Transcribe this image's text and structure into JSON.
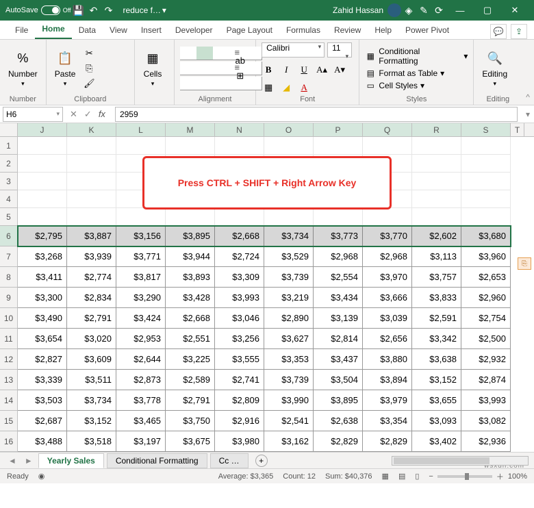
{
  "titlebar": {
    "autosave_label": "AutoSave",
    "autosave_state": "Off",
    "file_name": "reduce f…",
    "user_name": "Zahid Hassan"
  },
  "tabs": {
    "file": "File",
    "home": "Home",
    "data": "Data",
    "view": "View",
    "insert": "Insert",
    "developer": "Developer",
    "page_layout": "Page Layout",
    "formulas": "Formulas",
    "review": "Review",
    "help": "Help",
    "power_pivot": "Power Pivot"
  },
  "ribbon": {
    "number_group": "Number",
    "number_btn": "Number",
    "clipboard_group": "Clipboard",
    "paste_btn": "Paste",
    "cells_btn": "Cells",
    "alignment_group": "Alignment",
    "font_group": "Font",
    "font_name": "Calibri",
    "font_size": "11",
    "styles_group": "Styles",
    "cond_fmt": "Conditional Formatting",
    "fmt_table": "Format as Table",
    "cell_styles": "Cell Styles",
    "editing_group": "Editing",
    "editing_btn": "Editing"
  },
  "fx": {
    "name_box": "H6",
    "value": "2959"
  },
  "columns": [
    "J",
    "K",
    "L",
    "M",
    "N",
    "O",
    "P",
    "Q",
    "R",
    "S"
  ],
  "blank_rows": [
    "1",
    "2",
    "3",
    "4",
    "5"
  ],
  "data_rows": [
    {
      "n": "6",
      "v": [
        "$2,795",
        "$3,887",
        "$3,156",
        "$3,895",
        "$2,668",
        "$3,734",
        "$3,773",
        "$3,770",
        "$2,602",
        "$3,680"
      ]
    },
    {
      "n": "7",
      "v": [
        "$3,268",
        "$3,939",
        "$3,771",
        "$3,944",
        "$2,724",
        "$3,529",
        "$2,968",
        "$2,968",
        "$3,113",
        "$3,960"
      ]
    },
    {
      "n": "8",
      "v": [
        "$3,411",
        "$2,774",
        "$3,817",
        "$3,893",
        "$3,309",
        "$3,739",
        "$2,554",
        "$3,970",
        "$3,757",
        "$2,653"
      ]
    },
    {
      "n": "9",
      "v": [
        "$3,300",
        "$2,834",
        "$3,290",
        "$3,428",
        "$3,993",
        "$3,219",
        "$3,434",
        "$3,666",
        "$3,833",
        "$2,960"
      ]
    },
    {
      "n": "10",
      "v": [
        "$3,490",
        "$2,791",
        "$3,424",
        "$2,668",
        "$3,046",
        "$2,890",
        "$3,139",
        "$3,039",
        "$2,591",
        "$2,754"
      ]
    },
    {
      "n": "11",
      "v": [
        "$3,654",
        "$3,020",
        "$2,953",
        "$2,551",
        "$3,256",
        "$3,627",
        "$2,814",
        "$2,656",
        "$3,342",
        "$2,500"
      ]
    },
    {
      "n": "12",
      "v": [
        "$2,827",
        "$3,609",
        "$2,644",
        "$3,225",
        "$3,555",
        "$3,353",
        "$3,437",
        "$3,880",
        "$3,638",
        "$2,932"
      ]
    },
    {
      "n": "13",
      "v": [
        "$3,339",
        "$3,511",
        "$2,873",
        "$2,589",
        "$2,741",
        "$3,739",
        "$3,504",
        "$3,894",
        "$3,152",
        "$2,874"
      ]
    },
    {
      "n": "14",
      "v": [
        "$3,503",
        "$3,734",
        "$3,778",
        "$2,791",
        "$2,809",
        "$3,990",
        "$3,895",
        "$3,979",
        "$3,655",
        "$3,993"
      ]
    },
    {
      "n": "15",
      "v": [
        "$2,687",
        "$3,152",
        "$3,465",
        "$3,750",
        "$2,916",
        "$2,541",
        "$2,638",
        "$3,354",
        "$3,093",
        "$3,082"
      ]
    },
    {
      "n": "16",
      "v": [
        "$3,488",
        "$3,518",
        "$3,197",
        "$3,675",
        "$3,980",
        "$3,162",
        "$2,829",
        "$2,829",
        "$3,402",
        "$2,936"
      ]
    }
  ],
  "callout_text": "Press CTRL + SHIFT + Right Arrow Key",
  "sheets": {
    "active": "Yearly Sales",
    "tab2": "Conditional Formatting",
    "tab3": "Cc"
  },
  "statusbar": {
    "ready": "Ready",
    "avg_label": "Average:",
    "avg_val": "$3,365",
    "count_label": "Count:",
    "count_val": "12",
    "sum_label": "Sum:",
    "sum_val": "$40,376",
    "zoom": "100%"
  },
  "col_tail": "T",
  "watermark": "wsxdn.com"
}
